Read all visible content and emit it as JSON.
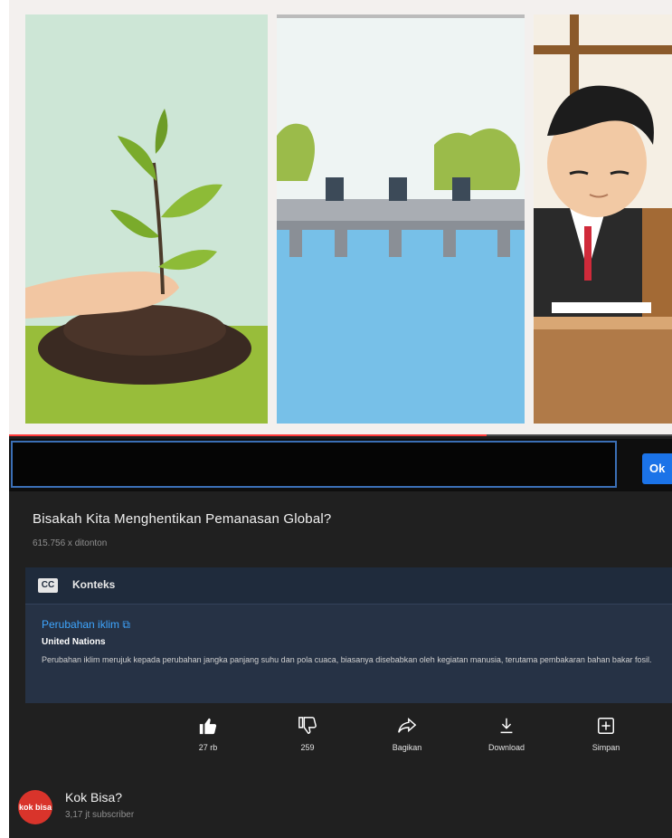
{
  "video": {
    "progress_fraction": 0.72
  },
  "search": {
    "value": "",
    "placeholder": "",
    "button_label": "Ok"
  },
  "video_info": {
    "title": "Bisakah Kita Menghentikan Pemanasan Global?",
    "views": "615.756 x ditonton"
  },
  "context_panel": {
    "heading": "Konteks",
    "icon_text": "CC",
    "link_text": "Perubahan iklim",
    "source": "United Nations",
    "description": "Perubahan iklim merujuk kepada perubahan jangka panjang suhu dan pola cuaca, biasanya disebabkan oleh kegiatan manusia, terutama pembakaran bahan bakar fosil."
  },
  "actions": [
    {
      "label": "27 rb",
      "icon": "thumbs-up-icon"
    },
    {
      "label": "259",
      "icon": "thumbs-down-icon"
    },
    {
      "label": "Bagikan",
      "icon": "share-icon"
    },
    {
      "label": "Download",
      "icon": "download-icon"
    },
    {
      "label": "Simpan",
      "icon": "save-icon"
    }
  ],
  "channel": {
    "name": "Kok Bisa?",
    "subscribers": "3,17 jt subscriber",
    "avatar_text": "kok bisa"
  },
  "colors": {
    "progress": "#ff3a3a",
    "search_border": "#3b6fb6",
    "search_button": "#1b73e8",
    "link": "#3ea6ff",
    "avatar": "#d9342b"
  }
}
